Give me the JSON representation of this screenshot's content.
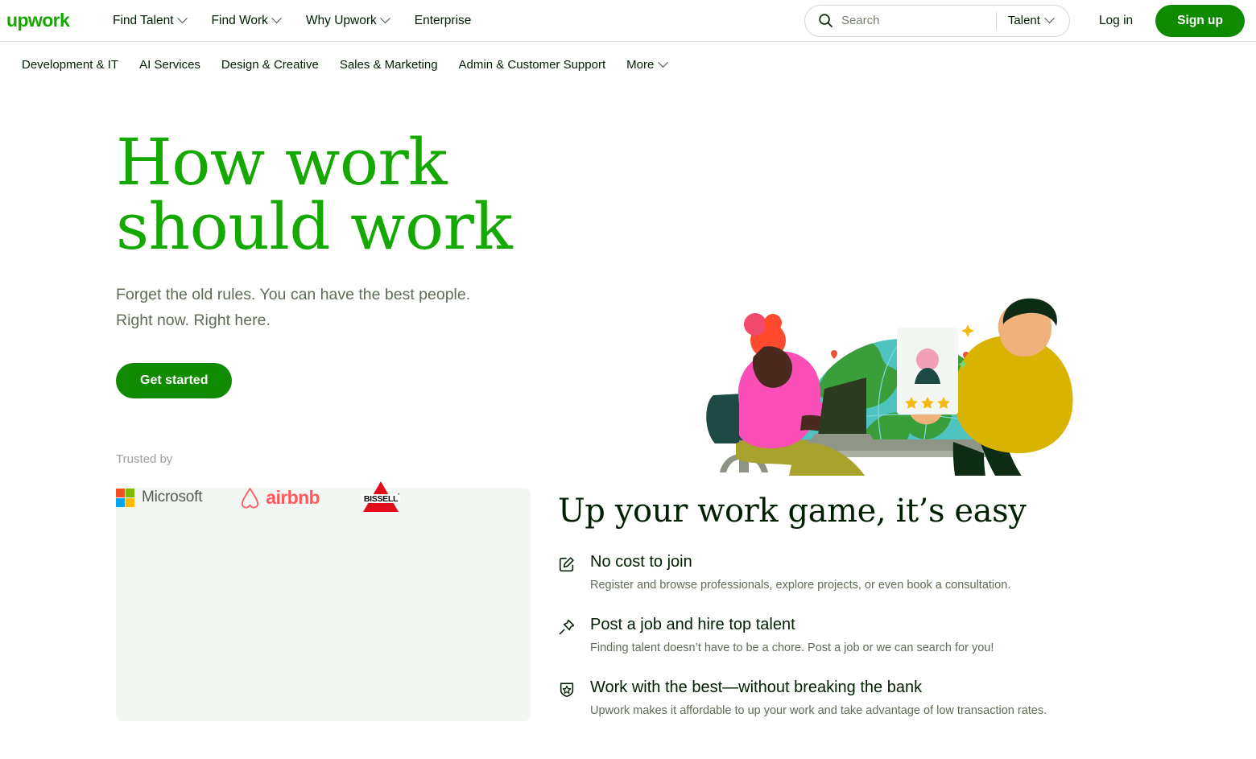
{
  "brand": {
    "logo_text": "upwork",
    "green": "#14a800",
    "button_green": "#108a00"
  },
  "header": {
    "nav": [
      {
        "label": "Find Talent",
        "has_caret": true
      },
      {
        "label": "Find Work",
        "has_caret": true
      },
      {
        "label": "Why Upwork",
        "has_caret": true
      },
      {
        "label": "Enterprise",
        "has_caret": false
      }
    ],
    "search": {
      "placeholder": "Search",
      "value": "",
      "scope": "Talent",
      "icon": "search-icon"
    },
    "login_label": "Log in",
    "signup_label": "Sign up"
  },
  "categories": [
    {
      "label": "Development & IT",
      "has_caret": false
    },
    {
      "label": "AI Services",
      "has_caret": false
    },
    {
      "label": "Design & Creative",
      "has_caret": false
    },
    {
      "label": "Sales & Marketing",
      "has_caret": false
    },
    {
      "label": "Admin & Customer Support",
      "has_caret": false
    },
    {
      "label": "More",
      "has_caret": true
    }
  ],
  "hero": {
    "title_line1": "How work",
    "title_line2": "should work",
    "subtitle_line1": "Forget the old rules. You can have the best people.",
    "subtitle_line2": "Right now. Right here.",
    "cta_label": "Get started",
    "trusted_label": "Trusted by",
    "logos": [
      {
        "name": "Microsoft",
        "icon": "microsoft-logo"
      },
      {
        "name": "airbnb",
        "icon": "airbnb-logo"
      },
      {
        "name": "BISSELL",
        "icon": "bissell-logo"
      }
    ],
    "illustration": "two-people-with-globe-illustration"
  },
  "features": {
    "title": "Up your work game, it’s easy",
    "items": [
      {
        "icon": "pen-edit-icon",
        "heading": "No cost to join",
        "text": "Register and browse professionals, explore projects, or even book a consultation."
      },
      {
        "icon": "pushpin-icon",
        "heading": "Post a job and hire top talent",
        "text": "Finding talent doesn’t have to be a chore. Post a job or we can search for you!"
      },
      {
        "icon": "shield-star-icon",
        "heading": "Work with the best—without breaking the bank",
        "text": "Upwork makes it affordable to up your work and take advantage of low transaction rates."
      }
    ]
  },
  "media": {
    "video_placeholder": "video-placeholder"
  }
}
